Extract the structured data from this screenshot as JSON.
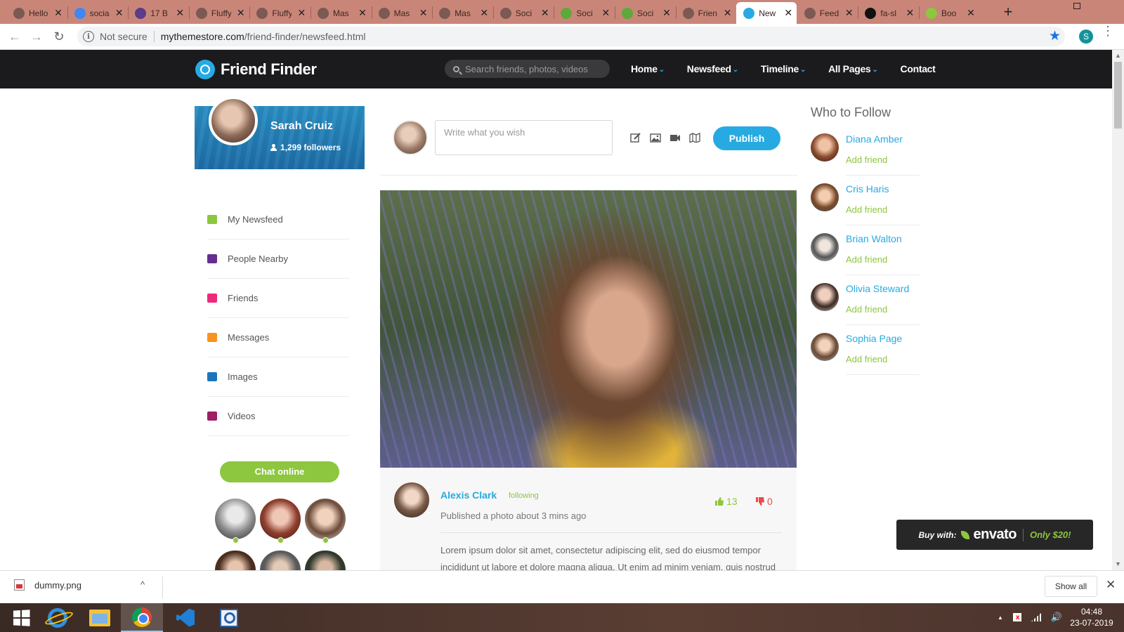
{
  "browser": {
    "tabs": [
      {
        "title": "Hello",
        "favicon": "page-icon",
        "color": "#7a5a52"
      },
      {
        "title": "social",
        "favicon": "google-icon",
        "color": "#4285f4"
      },
      {
        "title": "17 B",
        "favicon": "colorlib-icon",
        "color": "#5b3c88"
      },
      {
        "title": "Fluffy",
        "favicon": "page-icon",
        "color": "#7a5a52"
      },
      {
        "title": "Fluffy",
        "favicon": "page-icon",
        "color": "#7a5a52"
      },
      {
        "title": "Mas",
        "favicon": "page-icon",
        "color": "#7a5a52"
      },
      {
        "title": "Mas",
        "favicon": "page-icon",
        "color": "#7a5a52"
      },
      {
        "title": "Mas",
        "favicon": "page-icon",
        "color": "#7a5a52"
      },
      {
        "title": "Soci",
        "favicon": "page-icon",
        "color": "#7a5a52"
      },
      {
        "title": "Soci",
        "favicon": "envato-icon",
        "color": "#5fa83a"
      },
      {
        "title": "Soci",
        "favicon": "envato-icon",
        "color": "#5fa83a"
      },
      {
        "title": "Frien",
        "favicon": "page-icon",
        "color": "#7a5a52"
      },
      {
        "title": "New",
        "favicon": "friend-finder-icon",
        "color": "#27aae1",
        "active": true
      },
      {
        "title": "Feed",
        "favicon": "page-icon",
        "color": "#7a5a52"
      },
      {
        "title": "fa-sl",
        "favicon": "fa-icon",
        "color": "#111111"
      },
      {
        "title": "Boo",
        "favicon": "bootsnipp-icon",
        "color": "#8dc63f"
      }
    ],
    "tab_close": "✕",
    "new_tab": "+",
    "security_label": "Not secure",
    "url_host": "mythemestore.com",
    "url_path": "/friend-finder/newsfeed.html",
    "profile_initial": "S",
    "info_glyph": "i",
    "back_glyph": "←",
    "forward_glyph": "→",
    "reload_glyph": "↻",
    "star_glyph": "★",
    "menu_glyph": "⋮"
  },
  "site": {
    "brand": "Friend Finder",
    "search_placeholder": "Search friends, photos, videos",
    "nav": [
      {
        "label": "Home",
        "dropdown": true
      },
      {
        "label": "Newsfeed",
        "dropdown": true
      },
      {
        "label": "Timeline",
        "dropdown": true
      },
      {
        "label": "All Pages",
        "dropdown": true
      },
      {
        "label": "Contact",
        "dropdown": false
      }
    ],
    "caret": "⌄",
    "accent_color": "#27aae1",
    "green_color": "#8dc63f"
  },
  "profile": {
    "name": "Sarah Cruiz",
    "followers": "1,299 followers"
  },
  "sidebar": {
    "items": [
      {
        "label": "My Newsfeed",
        "icon": "newsfeed-icon",
        "color": "#8dc63f"
      },
      {
        "label": "People Nearby",
        "icon": "people-nearby-icon",
        "color": "#662d91"
      },
      {
        "label": "Friends",
        "icon": "friends-icon",
        "color": "#ee2a7b"
      },
      {
        "label": "Messages",
        "icon": "messages-icon",
        "color": "#f7931e"
      },
      {
        "label": "Images",
        "icon": "images-icon",
        "color": "#1c75bc"
      },
      {
        "label": "Videos",
        "icon": "videos-icon",
        "color": "#9e1f63"
      }
    ],
    "chat_label": "Chat online"
  },
  "composer": {
    "placeholder": "Write what you wish",
    "tools": [
      "edit-icon",
      "image-icon",
      "video-camera-icon",
      "map-icon"
    ],
    "publish_label": "Publish"
  },
  "post": {
    "author": "Alexis Clark",
    "following_label": "following",
    "meta": "Published a photo about 3 mins ago",
    "likes": "13",
    "dislikes": "0",
    "text": "Lorem ipsum dolor sit amet, consectetur adipiscing elit, sed do eiusmod tempor incididunt ut labore et dolore magna aliqua. Ut enim ad minim veniam, quis nostrud"
  },
  "who_to_follow": {
    "title": "Who to Follow",
    "people": [
      {
        "name": "Diana Amber",
        "action": "Add friend"
      },
      {
        "name": "Cris Haris",
        "action": "Add friend"
      },
      {
        "name": "Brian Walton",
        "action": "Add friend"
      },
      {
        "name": "Olivia Steward",
        "action": "Add friend"
      },
      {
        "name": "Sophia Page",
        "action": "Add friend"
      }
    ]
  },
  "envato": {
    "buy_with": "Buy with:",
    "brand": "envato",
    "price": "Only $20!"
  },
  "downloads": {
    "file": "dummy.png",
    "show_all": "Show all",
    "chevron": "^",
    "close": "✕"
  },
  "taskbar": {
    "apps": [
      "windows-start-icon",
      "internet-explorer-icon",
      "file-explorer-icon",
      "chrome-icon",
      "vscode-icon",
      "search-app-icon"
    ],
    "time": "04:48",
    "date": "23-07-2019",
    "tray_up": "▲",
    "speaker": "🔊"
  }
}
